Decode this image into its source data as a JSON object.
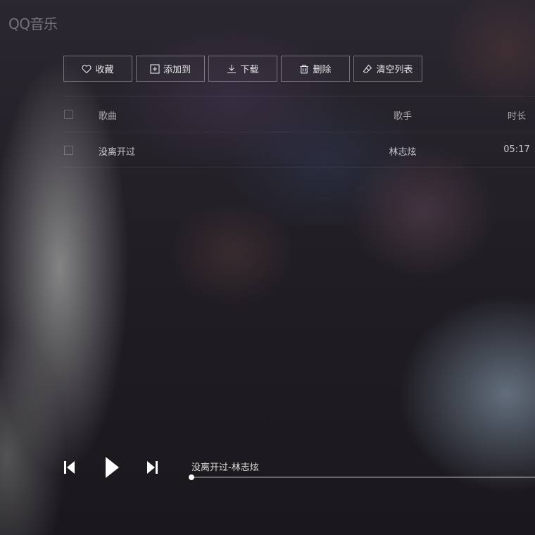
{
  "app": {
    "logo": "QQ音乐"
  },
  "toolbar": {
    "buttons": [
      {
        "label": "收藏",
        "icon": "heart-icon"
      },
      {
        "label": "添加到",
        "icon": "add-box-icon"
      },
      {
        "label": "下载",
        "icon": "download-icon"
      },
      {
        "label": "删除",
        "icon": "trash-icon"
      },
      {
        "label": "清空列表",
        "icon": "eraser-icon"
      }
    ]
  },
  "table": {
    "headers": {
      "song": "歌曲",
      "artist": "歌手",
      "duration": "时长"
    },
    "rows": [
      {
        "song": "没离开过",
        "artist": "林志炫",
        "duration": "05:17"
      }
    ]
  },
  "player": {
    "now_playing": "没离开过-林志炫",
    "progress": 0.0,
    "controls": [
      "prev-icon",
      "play-icon",
      "next-icon"
    ]
  },
  "colors": {
    "text": "#e6e6e6",
    "border": "#ffffff59",
    "progress": "#ffffff"
  }
}
